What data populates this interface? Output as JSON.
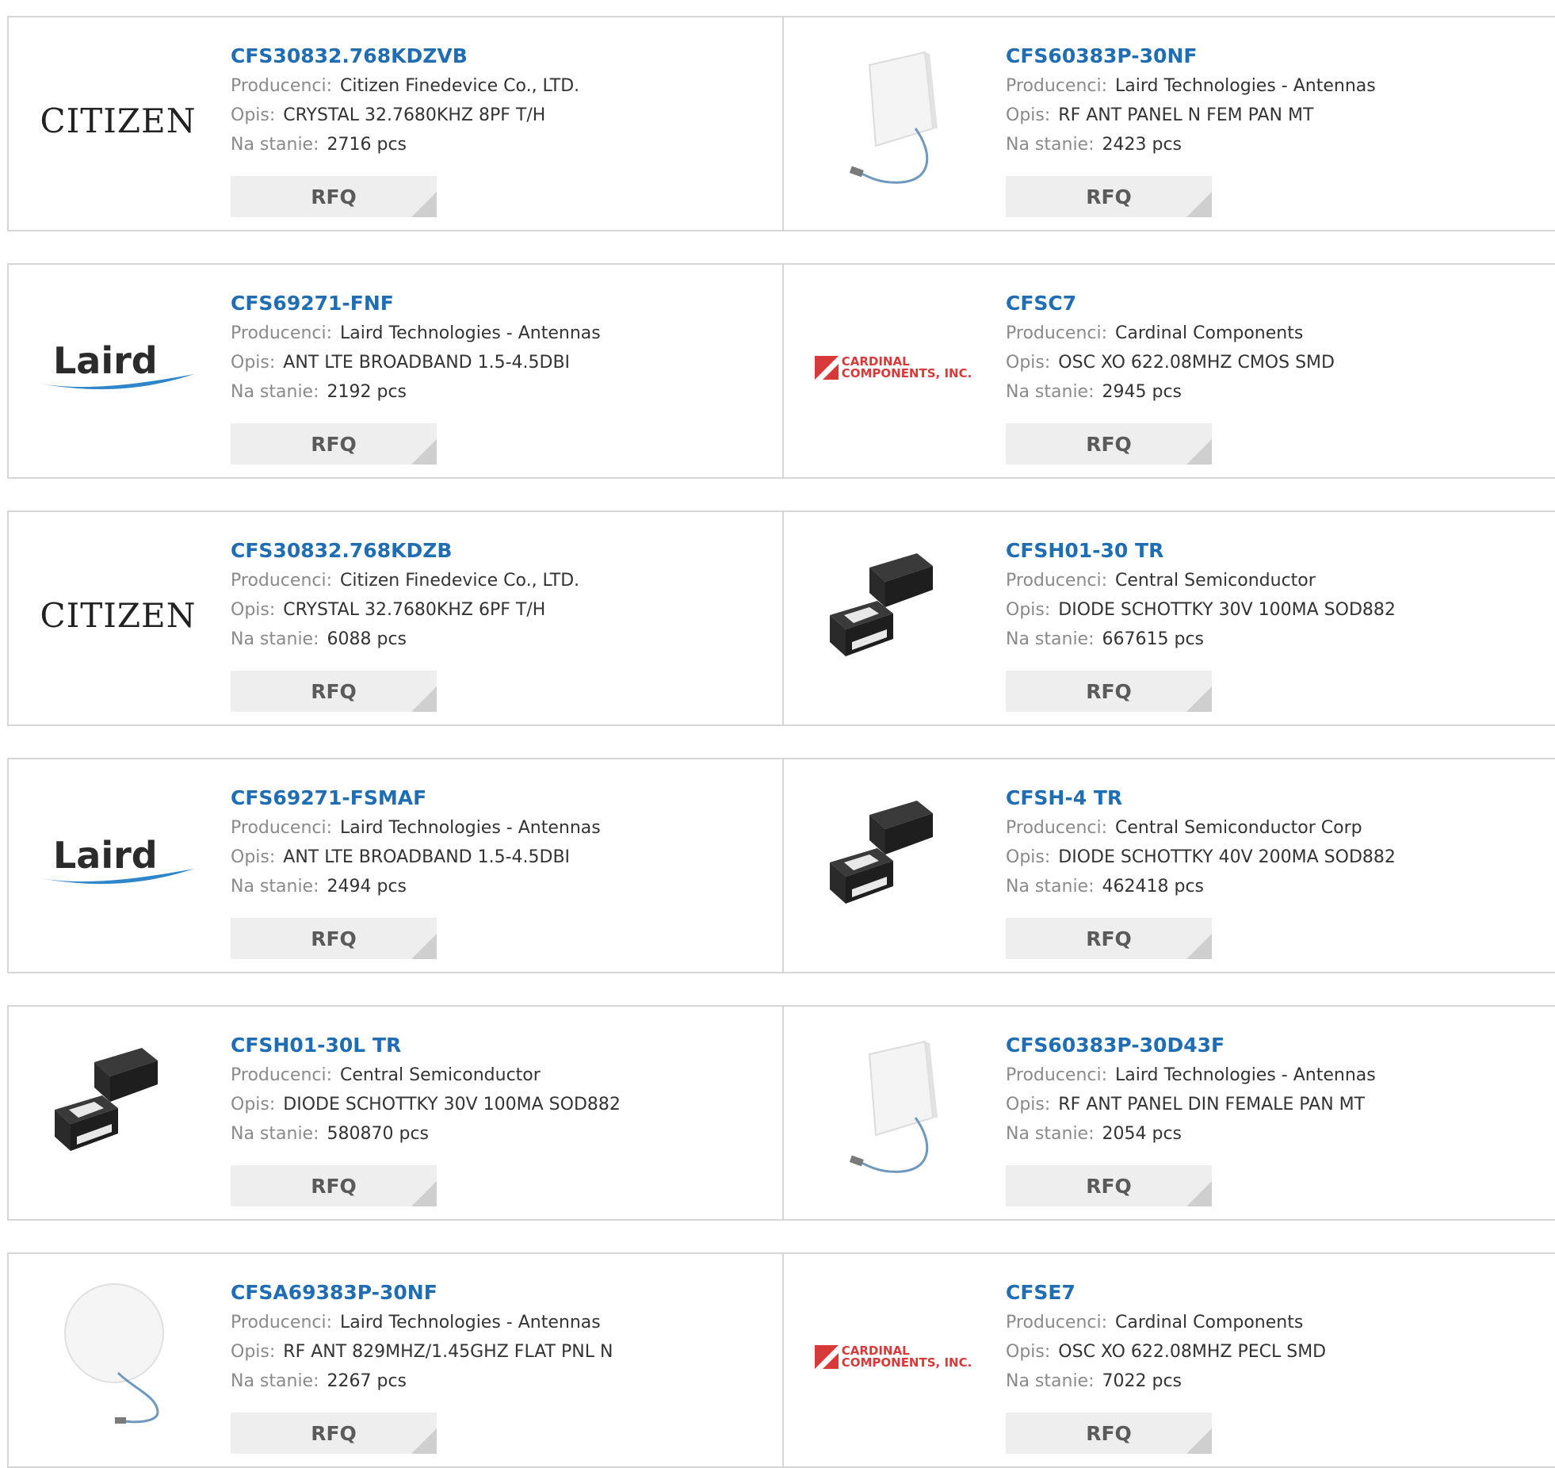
{
  "labels": {
    "manufacturer": "Producenci:",
    "description": "Opis:",
    "stock": "Na stanie:",
    "rfq": "RFQ"
  },
  "logos": {
    "citizen": "CITIZEN",
    "laird": "Laird",
    "cardinal_line1": "CARDINAL",
    "cardinal_line2": "COMPONENTS, INC."
  },
  "colors": {
    "link": "#1f6db3",
    "label": "#8a8a8a",
    "border": "#d6d6d6",
    "button_bg": "#eeeeee",
    "cardinal_red": "#d83a3a",
    "laird_swoosh": "#2f86c8"
  },
  "products": [
    {
      "part": "CFS30832.768KDZVB",
      "manufacturer": "Citizen Finedevice Co., LTD.",
      "description": "CRYSTAL 32.7680KHZ 8PF T/H",
      "stock": "2716 pcs",
      "image": "citizen-logo"
    },
    {
      "part": "CFS60383P-30NF",
      "manufacturer": "Laird Technologies - Antennas",
      "description": "RF ANT PANEL N FEM PAN MT",
      "stock": "2423 pcs",
      "image": "panel-antenna-icon"
    },
    {
      "part": "CFS69271-FNF",
      "manufacturer": "Laird Technologies - Antennas",
      "description": "ANT LTE BROADBAND 1.5-4.5DBI",
      "stock": "2192 pcs",
      "image": "laird-logo"
    },
    {
      "part": "CFSC7",
      "manufacturer": "Cardinal Components",
      "description": "OSC XO 622.08MHZ CMOS SMD",
      "stock": "2945 pcs",
      "image": "cardinal-logo"
    },
    {
      "part": "CFS30832.768KDZB",
      "manufacturer": "Citizen Finedevice Co., LTD.",
      "description": "CRYSTAL 32.7680KHZ 6PF T/H",
      "stock": "6088 pcs",
      "image": "citizen-logo"
    },
    {
      "part": "CFSH01-30 TR",
      "manufacturer": "Central Semiconductor",
      "description": "DIODE SCHOTTKY 30V 100MA SOD882",
      "stock": "667615 pcs",
      "image": "diode-package-icon"
    },
    {
      "part": "CFS69271-FSMAF",
      "manufacturer": "Laird Technologies - Antennas",
      "description": "ANT LTE BROADBAND 1.5-4.5DBI",
      "stock": "2494 pcs",
      "image": "laird-logo"
    },
    {
      "part": "CFSH-4 TR",
      "manufacturer": "Central Semiconductor Corp",
      "description": "DIODE SCHOTTKY 40V 200MA SOD882",
      "stock": "462418 pcs",
      "image": "diode-package-icon"
    },
    {
      "part": "CFSH01-30L TR",
      "manufacturer": "Central Semiconductor",
      "description": "DIODE SCHOTTKY 30V 100MA SOD882",
      "stock": "580870 pcs",
      "image": "diode-package-icon"
    },
    {
      "part": "CFS60383P-30D43F",
      "manufacturer": "Laird Technologies - Antennas",
      "description": "RF ANT PANEL DIN FEMALE PAN MT",
      "stock": "2054 pcs",
      "image": "panel-antenna-icon"
    },
    {
      "part": "CFSA69383P-30NF",
      "manufacturer": "Laird Technologies - Antennas",
      "description": "RF ANT 829MHZ/1.45GHZ FLAT PNL N",
      "stock": "2267 pcs",
      "image": "round-antenna-icon"
    },
    {
      "part": "CFSE7",
      "manufacturer": "Cardinal Components",
      "description": "OSC XO 622.08MHZ PECL SMD",
      "stock": "7022 pcs",
      "image": "cardinal-logo"
    }
  ]
}
